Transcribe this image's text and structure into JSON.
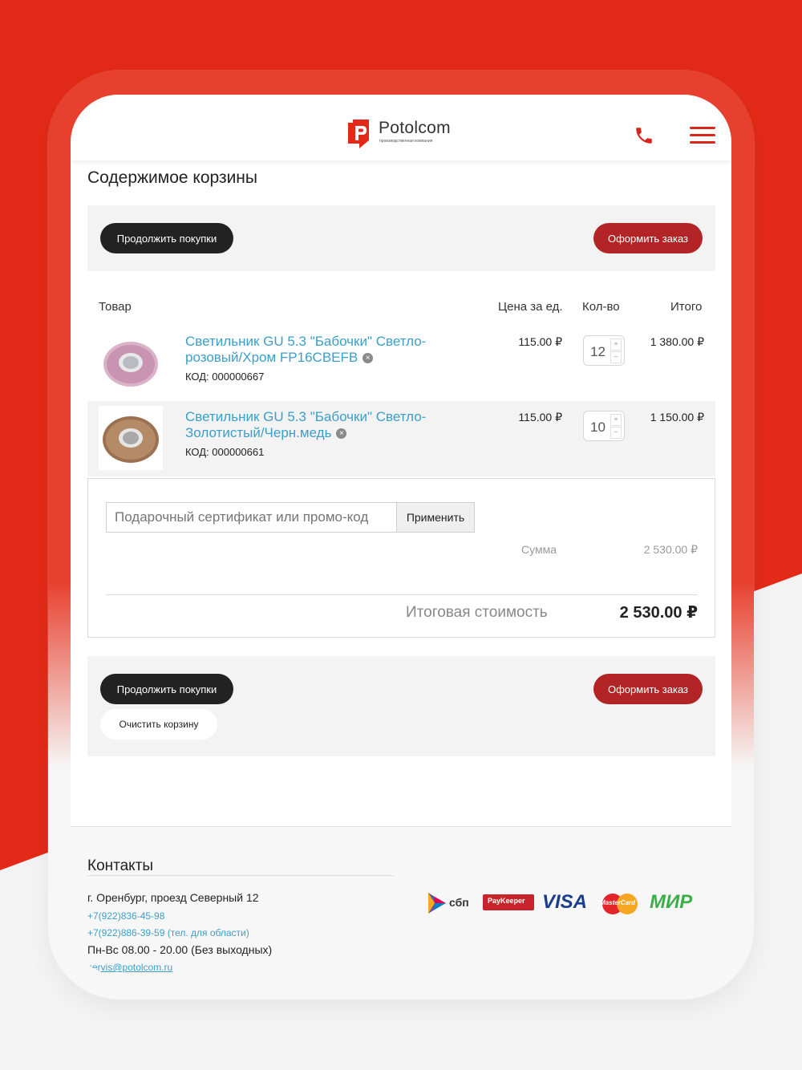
{
  "header": {
    "logo_text": "Potolcom",
    "logo_sub": "производственная компания"
  },
  "page": {
    "title": "Содержимое корзины"
  },
  "buttons": {
    "continue": "Продолжить покупки",
    "checkout": "Оформить заказ",
    "clear": "Очистить корзину",
    "apply": "Применить"
  },
  "table": {
    "headers": [
      "Товар",
      "Цена за ед.",
      "Кол-во",
      "Итого"
    ],
    "rows": [
      {
        "name": "Светильник GU 5.3 \"Бабочки\" Светло-розовый/Хром FP16CBEFB",
        "code": "КОД: 000000667",
        "price": "115.00 ₽",
        "qty": "12",
        "total": "1 380.00 ₽"
      },
      {
        "name": "Светильник GU 5.3 \"Бабочки\" Светло-Золотистый/Черн.медь",
        "code": "КОД: 000000661",
        "price": "115.00 ₽",
        "qty": "10",
        "total": "1 150.00 ₽"
      }
    ]
  },
  "summary": {
    "promo_placeholder": "Подарочный сертификат или промо-код",
    "sum_label": "Сумма",
    "sum_value": "2 530.00 ₽",
    "total_label": "Итоговая стоимость",
    "total_value": "2 530.00 ₽"
  },
  "footer": {
    "title": "Контакты",
    "address": "г. Оренбург, проезд Северный 12",
    "phone1": "+7(922)836-45-98",
    "phone2": "+7(922)886-39-59 (тел. для области)",
    "hours": "Пн-Вс 08.00 - 20.00 (Без выходных)",
    "email": "servis@potolcom.ru",
    "payments": {
      "sbp": "сбп",
      "paykeeper": "PayKeeper",
      "visa": "VISA",
      "mastercard": "MasterCard",
      "mir": "МИР"
    }
  },
  "colors": {
    "brand_red": "#e32a18",
    "button_red": "#b22425",
    "button_dark": "#222222",
    "link_blue": "#3a9fc9"
  }
}
